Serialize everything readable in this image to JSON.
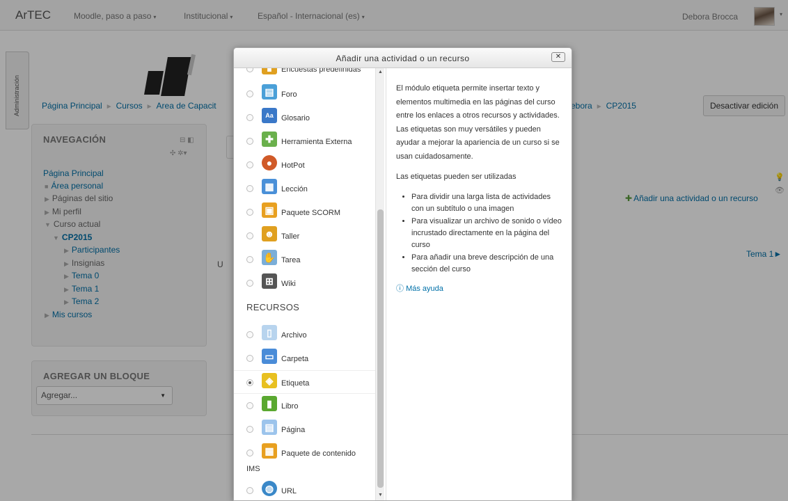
{
  "navbar": {
    "brand": "ArTEC",
    "menu": [
      {
        "label": "Moodle, paso a paso",
        "caret": "▾"
      },
      {
        "label": "Institucional",
        "caret": "▾"
      },
      {
        "label": "Español - Internacional (es)",
        "caret": "▾"
      }
    ],
    "user": "Debora Brocca",
    "user_caret": "▾"
  },
  "admin_tab": "Administración",
  "breadcrumb": {
    "left": [
      "Página Principal",
      "Cursos",
      "Area de Capacit"
    ],
    "right": [
      "ebora",
      "CP2015"
    ],
    "separator": "►"
  },
  "edit_button": "Desactivar edición",
  "navigation": {
    "title": "NAVEGACIÓN",
    "controls": "⊟ ◧",
    "controls2": "✣ ✲▾",
    "items": [
      {
        "label": "Página Principal",
        "arrow": ""
      },
      {
        "label": "Área personal",
        "arrow": "■"
      },
      {
        "label": "Páginas del sitio",
        "arrow": "▶"
      },
      {
        "label": "Mi perfil",
        "arrow": "▶"
      },
      {
        "label": "Curso actual",
        "arrow": "▼"
      },
      {
        "label": "CP2015",
        "arrow": "▼"
      },
      {
        "label": "Participantes",
        "arrow": "▶"
      },
      {
        "label": "Insignias",
        "arrow": "▶"
      },
      {
        "label": "Tema 0",
        "arrow": "▶"
      },
      {
        "label": "Tema 1",
        "arrow": "▶"
      },
      {
        "label": "Tema 2",
        "arrow": "▶"
      },
      {
        "label": "Mis cursos",
        "arrow": "▶"
      }
    ]
  },
  "add_block": {
    "title": "AGREGAR UN BLOQUE",
    "select_value": "Agregar...",
    "select_caret": "▼"
  },
  "content": {
    "u_letter": "U",
    "add_activity": "Añadir una actividad o un recurso",
    "add_plus": "✚",
    "tema_link": "Tema 1►",
    "lamp": "💡",
    "eye": "👁"
  },
  "dialog": {
    "title": "Añadir una actividad o un recurso",
    "close": "✕",
    "activities": [
      {
        "label": "Encuestas predefinidas",
        "icon": "survey-icon",
        "color": "#e0a020"
      },
      {
        "label": "Foro",
        "icon": "forum-icon",
        "color": "#4aa0d8"
      },
      {
        "label": "Glosario",
        "icon": "glossary-icon",
        "color": "#3a78c8"
      },
      {
        "label": "Herramienta Externa",
        "icon": "puzzle-icon",
        "color": "#6ab04c"
      },
      {
        "label": "HotPot",
        "icon": "hotpot-icon",
        "color": "#d05a28"
      },
      {
        "label": "Lección",
        "icon": "lesson-icon",
        "color": "#4a90d8"
      },
      {
        "label": "Paquete SCORM",
        "icon": "scorm-icon",
        "color": "#e8a020"
      },
      {
        "label": "Taller",
        "icon": "workshop-icon",
        "color": "#e0a020"
      },
      {
        "label": "Tarea",
        "icon": "assignment-icon",
        "color": "#7aaed8"
      },
      {
        "label": "Wiki",
        "icon": "wiki-icon",
        "color": "#555555"
      }
    ],
    "resources_heading": "RECURSOS",
    "resources": [
      {
        "label": "Archivo",
        "icon": "file-icon",
        "color": "#b8d4ee"
      },
      {
        "label": "Carpeta",
        "icon": "folder-icon",
        "color": "#4a8cd8"
      },
      {
        "label": "Etiqueta",
        "icon": "label-icon",
        "color": "#e8c020",
        "selected": true
      },
      {
        "label": "Libro",
        "icon": "book-icon",
        "color": "#5aa830"
      },
      {
        "label": "Página",
        "icon": "page-icon",
        "color": "#9cc4ec"
      },
      {
        "label": "Paquete de contenido",
        "label2": "IMS",
        "icon": "ims-icon",
        "color": "#e8a020"
      },
      {
        "label": "URL",
        "icon": "url-icon",
        "color": "#3a88c8"
      }
    ],
    "help": {
      "p1": "El módulo etiqueta permite insertar texto y elementos multimedia en las páginas del curso entre los enlaces a otros recursos y actividades. Las etiquetas son muy versátiles y pueden ayudar a mejorar la apariencia de un curso si se usan cuidadosamente.",
      "p2": "Las etiquetas pueden ser utilizadas",
      "bullets": [
        "Para dividir una larga lista de actividades con un subtítulo o una imagen",
        "Para visualizar un archivo de sonido o vídeo incrustado directamente en la página del curso",
        "Para añadir una breve descripción de una sección del curso"
      ],
      "more_help": "Más ayuda",
      "more_help_icon": "ⓘ"
    }
  }
}
